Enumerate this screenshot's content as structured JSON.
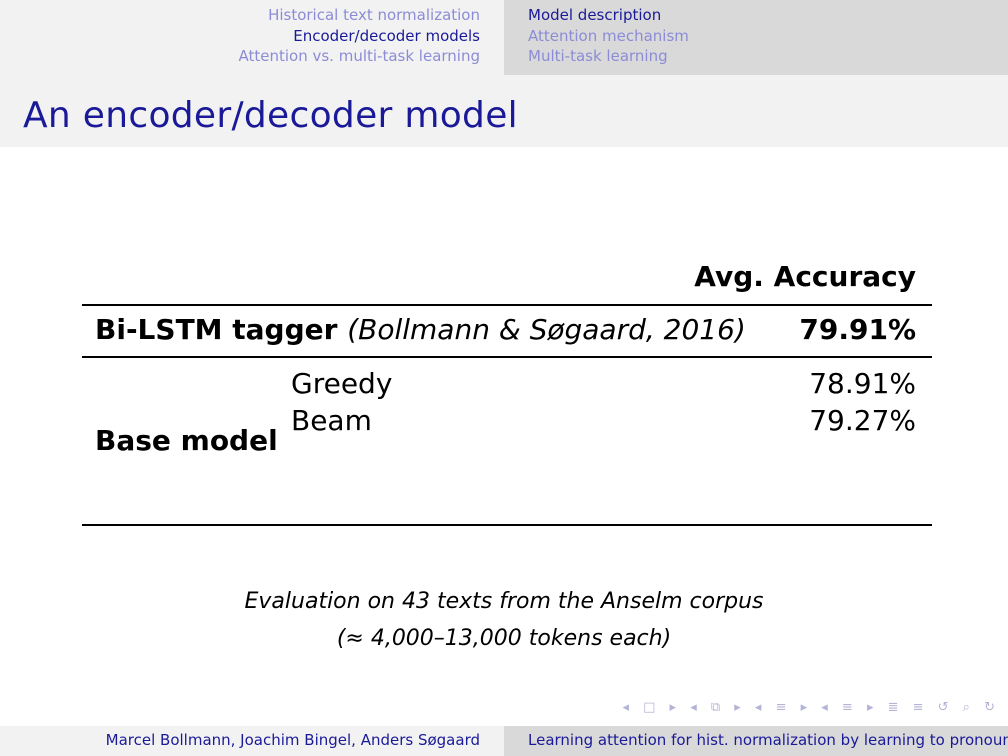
{
  "nav": {
    "left_items": [
      {
        "label": "Historical text normalization"
      },
      {
        "label": "Encoder/decoder models"
      },
      {
        "label": "Attention vs. multi-task learning"
      }
    ],
    "left_active_index": 1,
    "right_items": [
      {
        "label": "Model description"
      },
      {
        "label": "Attention mechanism"
      },
      {
        "label": "Multi-task learning"
      }
    ],
    "right_active_index": 0
  },
  "slide": {
    "title": "An encoder/decoder model"
  },
  "table": {
    "header": "Avg. Accuracy",
    "baseline": {
      "name": "Bi-LSTM tagger",
      "citation": "(Bollmann & Søgaard, 2016)",
      "value": "79.91%"
    },
    "group_label": "Base model",
    "rows": [
      {
        "method": "Greedy",
        "value": "78.91%"
      },
      {
        "method": "Beam",
        "value": "79.27%"
      }
    ]
  },
  "caption": {
    "line1": "Evaluation on 43 texts from the Anselm corpus",
    "line2": "(≈ 4,000–13,000 tokens each)"
  },
  "footer": {
    "authors": "Marcel Bollmann, Joachim Bingel, Anders Søgaard",
    "short_title": "Learning attention for hist. normalization by learning to pronounce"
  },
  "icons": {
    "nav_symbols": "◂ □ ▸ ◂ ⧉ ▸ ◂ ≡ ▸ ◂ ≡ ▸ ≣ ≡ ↺ ⌕ ↻",
    "colors": {
      "accent": "#1a1a99",
      "inactive": "#8c8cd6"
    }
  }
}
